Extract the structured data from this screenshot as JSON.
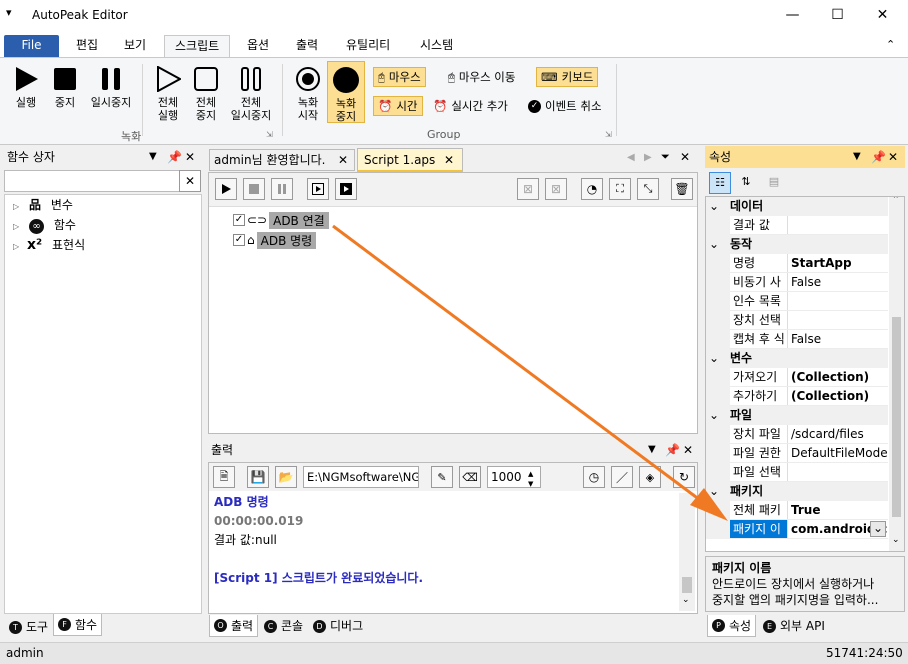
{
  "window": {
    "title": "AutoPeak Editor",
    "qa_icon": "dropdown-icon",
    "minimize": "—",
    "maximize": "☐",
    "close": "✕"
  },
  "ribbon_tabs": [
    "File",
    "편집",
    "보기",
    "스크립트",
    "옵션",
    "출력",
    "유틸리티",
    "시스템"
  ],
  "ribbon": {
    "record_group": {
      "label": "녹화",
      "buttons": [
        {
          "label1": "실행",
          "label2": ""
        },
        {
          "label1": "중지",
          "label2": ""
        },
        {
          "label1": "일시중지",
          "label2": ""
        },
        {
          "label1": "전체",
          "label2": "실행"
        },
        {
          "label1": "전체",
          "label2": "중지"
        },
        {
          "label1": "전체",
          "label2": "일시중지"
        }
      ]
    },
    "group_group": {
      "label": "Group",
      "start": {
        "label1": "녹화",
        "label2": "시작"
      },
      "stop": {
        "label1": "녹화",
        "label2": "중지"
      },
      "mouse": "마우스",
      "mouse_move": "마우스 이동",
      "keyboard": "키보드",
      "time": "시간",
      "realtime_add": "실시간 추가",
      "event_cancel": "이벤트 취소"
    }
  },
  "left_panel": {
    "title": "함수 상자",
    "items": [
      "변수",
      "함수",
      "표현식"
    ],
    "bottom_tabs": [
      "도구",
      "함수"
    ]
  },
  "editor": {
    "tabs": [
      "admin님 환영합니다.",
      "Script 1.aps"
    ],
    "lines": [
      "ADB 연결",
      "ADB 명령"
    ]
  },
  "output": {
    "title": "출력",
    "path": "E:\\NGMsoftware\\NG",
    "count": "1000",
    "lines": [
      {
        "text": "ADB 명령",
        "color": "#2b2bbf"
      },
      {
        "text": "00:00:00.019",
        "color": "#777777"
      },
      {
        "text": "결과 값:null",
        "color": "#000000"
      },
      {
        "text": "",
        "color": "#000000"
      },
      {
        "text": "[Script 1] 스크립트가 완료되었습니다.",
        "color": "#2b2bbf"
      }
    ],
    "bottom_tabs": [
      "출력",
      "콘솔",
      "디버그"
    ]
  },
  "props": {
    "title": "속성",
    "rows": [
      {
        "cat": "데이터"
      },
      {
        "name": "결과 값",
        "value": "",
        "bold": false
      },
      {
        "cat": "동작"
      },
      {
        "name": "명령",
        "value": "StartApp",
        "bold": true
      },
      {
        "name": "비동기 사",
        "value": "False",
        "bold": false
      },
      {
        "name": "인수 목록",
        "value": "",
        "bold": false
      },
      {
        "name": "장치 선택",
        "value": "",
        "bold": false
      },
      {
        "name": "캡쳐 후 식",
        "value": "False",
        "bold": false
      },
      {
        "cat": "변수"
      },
      {
        "name": "가져오기",
        "value": "(Collection)",
        "bold": true
      },
      {
        "name": "추가하기",
        "value": "(Collection)",
        "bold": true
      },
      {
        "cat": "파일"
      },
      {
        "name": "장치 파일",
        "value": "/sdcard/files",
        "bold": false
      },
      {
        "name": "파일 권한",
        "value": "DefaultFileMode",
        "bold": false
      },
      {
        "name": "파일 선택",
        "value": "",
        "bold": false
      },
      {
        "cat": "패키지"
      },
      {
        "name": "전체 패키",
        "value": "True",
        "bold": true
      },
      {
        "name": "패키지 이",
        "value": "com.android.c",
        "bold": true,
        "selected": true
      }
    ],
    "desc_title": "패키지 이름",
    "desc_line1": "안드로이드 장치에서 실행하거나",
    "desc_line2": "중지할 앱의 패키지명을 입력하...",
    "bottom_tabs": [
      "속성",
      "외부 API"
    ]
  },
  "status": {
    "user": "admin",
    "time": "51741:24:50"
  },
  "colors": {
    "accent": "#2b5fad",
    "highlight": "#fcdf93",
    "arrow": "#f07a23",
    "selection": "#0078d7"
  }
}
